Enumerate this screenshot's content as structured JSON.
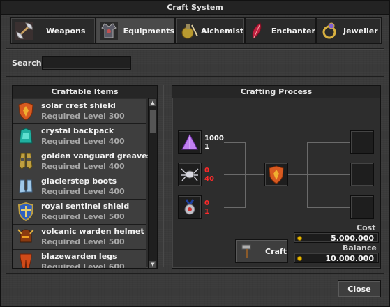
{
  "window": {
    "title": "Craft System"
  },
  "tabs": [
    {
      "label": "Weapons",
      "icon": "axe-icon",
      "active": false
    },
    {
      "label": "Equipments",
      "icon": "armor-icon",
      "active": true
    },
    {
      "label": "Alchemist",
      "icon": "potion-icon",
      "active": false
    },
    {
      "label": "Enchanter",
      "icon": "feather-icon",
      "active": false
    },
    {
      "label": "Jeweller",
      "icon": "ring-icon",
      "active": false
    }
  ],
  "search": {
    "label": "Search",
    "value": ""
  },
  "craftable": {
    "header": "Craftable Items",
    "items": [
      {
        "name": "solar crest shield",
        "level": "Required Level 300",
        "icon": "shield-icon"
      },
      {
        "name": "crystal backpack",
        "level": "Required Level 400",
        "icon": "backpack-icon"
      },
      {
        "name": "golden vanguard greaves",
        "level": "Required Level 400",
        "icon": "greaves-icon"
      },
      {
        "name": "glacierstep boots",
        "level": "Required Level 400",
        "icon": "boots-icon"
      },
      {
        "name": "royal sentinel shield",
        "level": "Required Level 500",
        "icon": "royal-shield-icon"
      },
      {
        "name": "volcanic warden helmet",
        "level": "Required Level 500",
        "icon": "helmet-icon"
      },
      {
        "name": "blazewarden legs",
        "level": "Required Level 600",
        "icon": "legs-icon"
      }
    ]
  },
  "process": {
    "header": "Crafting Process",
    "ingredients": [
      {
        "icon": "pyramid-icon",
        "have": "1000",
        "need": "1",
        "have_color": "#ffffff"
      },
      {
        "icon": "spider-icon",
        "have": "0",
        "need": "40",
        "have_color": "#ff2a2a"
      },
      {
        "icon": "medal-icon",
        "have": "0",
        "need": "1",
        "have_color": "#ff2a2a"
      }
    ],
    "result_icon": "shield-icon",
    "craft_label": "Craft",
    "cost_label": "Cost",
    "cost_value": "5.000.000",
    "balance_label": "Balance",
    "balance_value": "10.000.000"
  },
  "footer": {
    "close_label": "Close"
  },
  "colors": {
    "accent": "#e8b800",
    "error": "#ff2a2a"
  }
}
